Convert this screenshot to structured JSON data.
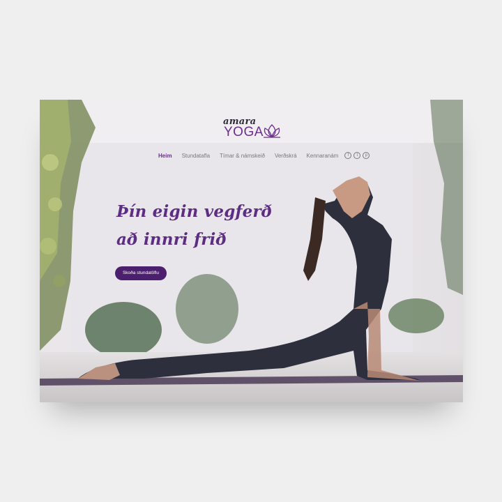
{
  "brand": {
    "logo_small": "amara",
    "logo_big": "YOGA",
    "logo_color": "#6a2f8c"
  },
  "nav": {
    "items": [
      {
        "label": "Heim",
        "active": true
      },
      {
        "label": "Stundatafla",
        "active": false
      },
      {
        "label": "Tímar & námskeið",
        "active": false
      },
      {
        "label": "Verðskrá",
        "active": false
      },
      {
        "label": "Kennaranám",
        "active": false
      }
    ],
    "social": [
      {
        "icon": "facebook-icon",
        "glyph": "f"
      },
      {
        "icon": "twitter-icon",
        "glyph": "t"
      },
      {
        "icon": "pinterest-icon",
        "glyph": "p"
      }
    ]
  },
  "hero": {
    "headline_line1": "Þín eigin vegferð",
    "headline_line2": "að innri frið",
    "cta_label": "Skoða stundatöflu",
    "accent": "#5c2d82",
    "button_color": "#4b1f6e"
  }
}
